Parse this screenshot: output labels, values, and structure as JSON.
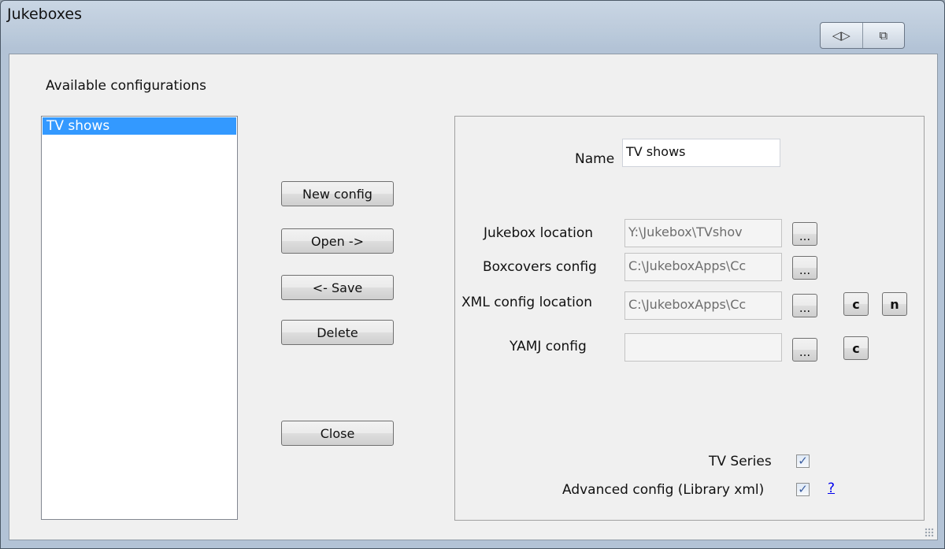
{
  "window": {
    "title": "Jukeboxes",
    "title_icons": [
      "resize-arrows-icon",
      "exit-icon"
    ],
    "title_glyphs": [
      "◁▷",
      "⧉"
    ]
  },
  "left": {
    "label": "Available configurations",
    "items": [
      "TV shows"
    ],
    "selected": "TV shows"
  },
  "actions": {
    "new_config": "New config",
    "open": "Open ->",
    "save": "<- Save",
    "delete": "Delete",
    "close": "Close"
  },
  "form": {
    "name_label": "Name",
    "name_value": "TV shows",
    "jukebox_label": "Jukebox location",
    "jukebox_value": "Y:\\Jukebox\\TVshov",
    "boxcovers_label": "Boxcovers config",
    "boxcovers_value": "C:\\JukeboxApps\\Cc",
    "xml_label": "XML config location",
    "xml_value": "C:\\JukeboxApps\\Cc",
    "yamj_label": "YAMJ config",
    "yamj_value": "",
    "browse_label": "...",
    "c_label": "c",
    "n_label": "n",
    "tv_series_label": "TV Series",
    "tv_series_checked": true,
    "advanced_label": "Advanced config (Library xml)",
    "advanced_checked": true,
    "help_label": "?",
    "check_glyph": "✓"
  }
}
